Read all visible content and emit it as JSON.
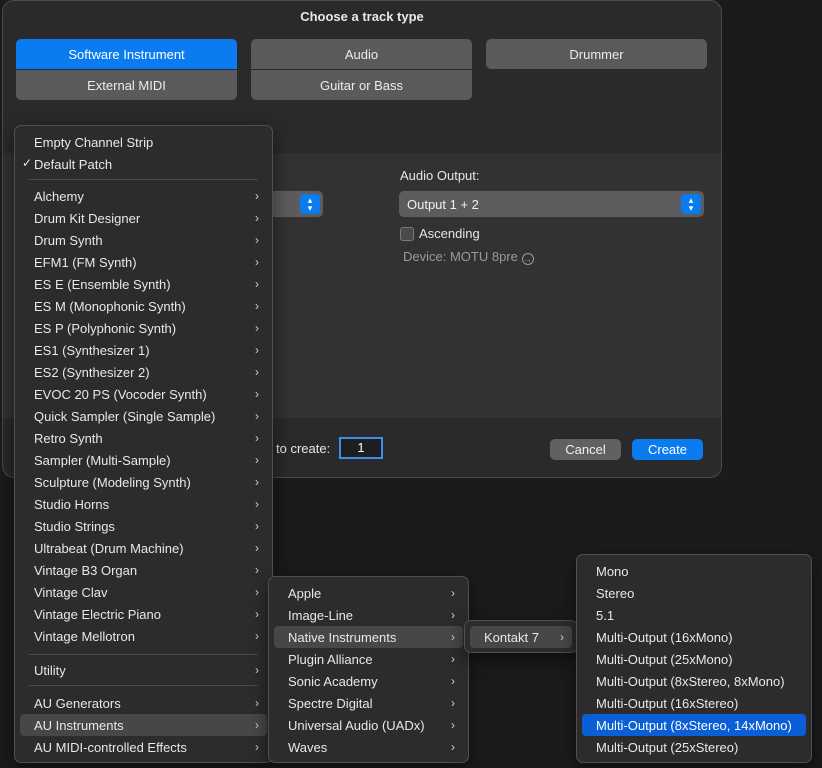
{
  "dialog": {
    "title": "Choose a track type",
    "types": {
      "software_instrument": "Software Instrument",
      "audio": "Audio",
      "drummer": "Drummer",
      "external_midi": "External MIDI",
      "guitar_bass": "Guitar or Bass"
    },
    "audio_output_label": "Audio Output:",
    "audio_output_value": "Output 1 + 2",
    "ascending_label": "Ascending",
    "device_label": "Device: MOTU 8pre",
    "create_count_label": "to create:",
    "create_count_value": "1",
    "cancel": "Cancel",
    "create": "Create"
  },
  "main_menu": {
    "top": [
      "Empty Channel Strip",
      "Default Patch"
    ],
    "check_mark": "✓",
    "instruments": [
      "Alchemy",
      "Drum Kit Designer",
      "Drum Synth",
      "EFM1  (FM Synth)",
      "ES E  (Ensemble Synth)",
      "ES M  (Monophonic Synth)",
      "ES P  (Polyphonic Synth)",
      "ES1  (Synthesizer 1)",
      "ES2  (Synthesizer 2)",
      "EVOC 20 PS  (Vocoder Synth)",
      "Quick Sampler (Single Sample)",
      "Retro Synth",
      "Sampler (Multi-Sample)",
      "Sculpture  (Modeling Synth)",
      "Studio Horns",
      "Studio Strings",
      "Ultrabeat (Drum Machine)",
      "Vintage B3 Organ",
      "Vintage Clav",
      "Vintage Electric Piano",
      "Vintage Mellotron"
    ],
    "utility": "Utility",
    "au": [
      "AU Generators",
      "AU Instruments",
      "AU MIDI-controlled Effects"
    ]
  },
  "vendor_menu": [
    "Apple",
    "Image-Line",
    "Native Instruments",
    "Plugin Alliance",
    "Sonic Academy",
    "Spectre Digital",
    "Universal Audio (UADx)",
    "Waves"
  ],
  "ni_menu": [
    "Kontakt 7"
  ],
  "output_menu": [
    "Mono",
    "Stereo",
    "5.1",
    "Multi-Output (16xMono)",
    "Multi-Output (25xMono)",
    "Multi-Output (8xStereo, 8xMono)",
    "Multi-Output (16xStereo)",
    "Multi-Output (8xStereo, 14xMono)",
    "Multi-Output (25xStereo)"
  ],
  "chevron": "›",
  "colors": {
    "accent": "#0a7cf0",
    "highlight": "#0a5ed6"
  }
}
